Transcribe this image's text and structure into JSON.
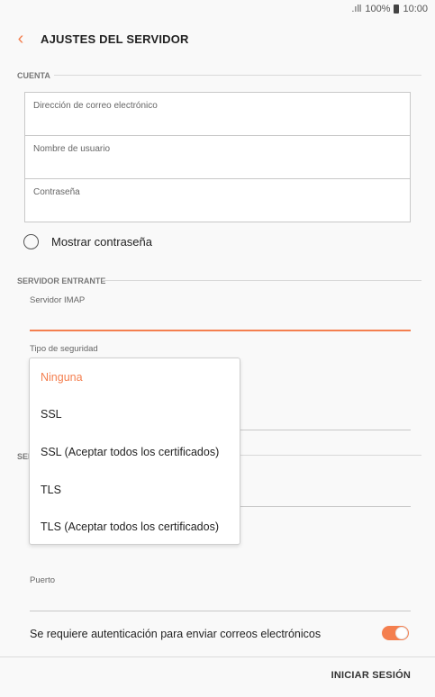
{
  "status": {
    "signal": ".ıll",
    "battery": "100%",
    "time": "10:00"
  },
  "header": {
    "title": "AJUSTES DEL SERVIDOR"
  },
  "account": {
    "section_label": "CUENTA",
    "email_placeholder": "Dirección de correo electrónico",
    "username_placeholder": "Nombre de usuario",
    "password_placeholder": "Contraseña",
    "show_password_label": "Mostrar contraseña"
  },
  "incoming": {
    "section_label": "SERVIDOR ENTRANTE",
    "imap_label": "Servidor IMAP",
    "security_label": "Tipo de seguridad"
  },
  "security_menu": {
    "options": [
      "Ninguna",
      "SSL",
      "SSL (Aceptar todos los certificados)",
      "TLS",
      "TLS (Aceptar todos los certificados)"
    ],
    "selected": "Ninguna"
  },
  "outgoing": {
    "section_label_visible": "SEI",
    "port_label": "Puerto",
    "auth_label": "Se requiere autenticación para enviar correos electrónicos",
    "auth_enabled": true
  },
  "footer": {
    "login_button": "INICIAR SESIÓN"
  },
  "colors": {
    "accent": "#f47f4f"
  }
}
